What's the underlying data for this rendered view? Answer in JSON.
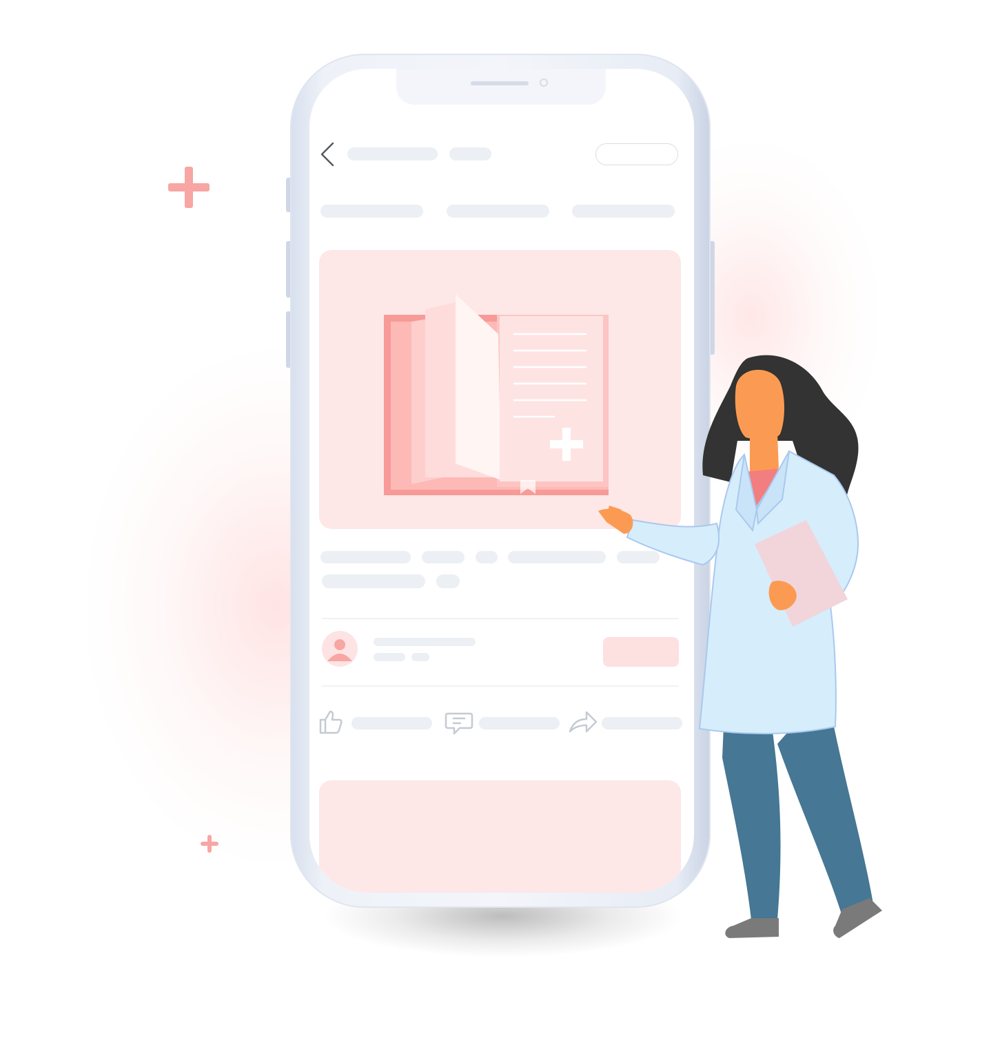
{
  "scene": {
    "accent_color": "#f7a6a3",
    "card_color": "#fde7e7",
    "skeleton_color": "#eceff3",
    "icons": [
      "back-arrow-icon",
      "medical-book-icon",
      "user-avatar-icon",
      "thumbs-up-icon",
      "comment-icon",
      "share-icon",
      "plus-cross-icon"
    ]
  },
  "app": {
    "header": {
      "follow_label": ""
    },
    "post": {
      "title": "",
      "body": ""
    },
    "author": {
      "name": ""
    },
    "actions": {
      "like_label": "",
      "comment_label": "",
      "share_label": ""
    }
  }
}
